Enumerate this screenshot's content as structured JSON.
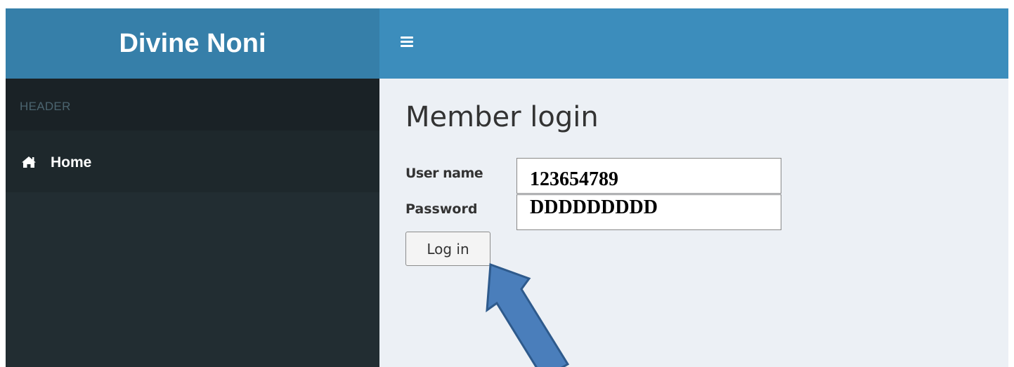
{
  "brand": {
    "title": "Divine Noni",
    "color": "#367fa9"
  },
  "topbar": {
    "color": "#3c8dbc",
    "menu_icon": "hamburger-menu-icon"
  },
  "sidebar": {
    "header": "HEADER",
    "items": [
      {
        "label": "Home",
        "icon": "home-icon"
      }
    ]
  },
  "main": {
    "title": "Member login",
    "form": {
      "username_label": "User name",
      "username_value": "123654789",
      "password_label": "Password",
      "password_value": "DDDDDDDDD",
      "login_button": "Log in"
    }
  },
  "annotation": {
    "icon": "pointing-arrow",
    "color": "#4a7ebb"
  }
}
